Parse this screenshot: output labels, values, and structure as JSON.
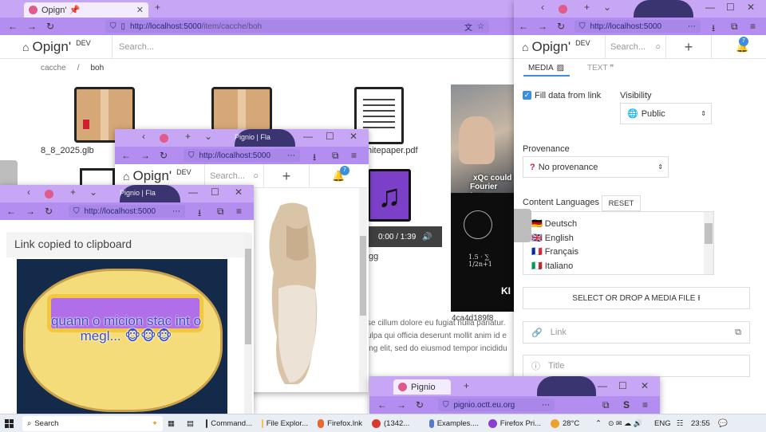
{
  "main": {
    "tab_title": "Opign' 📌",
    "url_prefix": "http://localhost:5000",
    "url_path": "/item/cacche/boh",
    "logo": "Opign'",
    "dev": "DEV",
    "search_placeholder": "Search...",
    "breadcrumb": [
      "cacche",
      "/",
      "boh"
    ],
    "files": [
      "8_8_2025.glb",
      "hitepaper.pdf",
      "gg"
    ],
    "audio_time": "0:00 / 1:39",
    "lorem": [
      "se cillum dolore eu fugiat nulla pariatur.",
      "ulpa qui officia deserunt mollit anim id e",
      "ing elit, sed do eiusmod tempor incididu"
    ],
    "video_caption": [
      "xQc could",
      "Fourier tran"
    ],
    "video_brand": "KI",
    "file_prefix": "4ca4d189f8"
  },
  "right": {
    "url": "http://localhost:5000",
    "logo": "Opign'",
    "dev": "DEV",
    "search_placeholder": "Search...",
    "badge": "7",
    "tab_media": "MEDIA",
    "tab_text": "TEXT ❞",
    "fill_label": "Fill data from link",
    "visibility_label": "Visibility",
    "visibility_value": "Public",
    "provenance_label": "Provenance",
    "provenance_value": "No provenance",
    "languages_label": "Content Languages",
    "reset": "RESET",
    "languages": [
      {
        "flag": "🇩🇪",
        "name": "Deutsch"
      },
      {
        "flag": "🇬🇧",
        "name": "English"
      },
      {
        "flag": "🇫🇷",
        "name": "Français"
      },
      {
        "flag": "🇮🇹",
        "name": "Italiano"
      }
    ],
    "drop_label": "SELECT OR DROP A MEDIA FILE ⭱",
    "link_placeholder": "Link",
    "title_placeholder": "Title"
  },
  "mid": {
    "tab_title": "Pignio | Fla",
    "url": "http://localhost:5000",
    "logo": "Opign'",
    "dev": "DEV",
    "search_placeholder": "Search...",
    "badge": "7"
  },
  "left": {
    "tab_title": "Pignio | Fla",
    "url": "http://localhost:5000",
    "toast": "Link copied to clipboard",
    "meme_text": "quann o micion stac int o megl... 🐵🐵🐵"
  },
  "bottom": {
    "tab_title": "Pignio",
    "url": "pignio.octt.eu.org"
  },
  "taskbar": {
    "search": "Search",
    "items": [
      "Command...",
      "File Explor...",
      "Firefox.lnk",
      "(1342...",
      "Examples....",
      "Firefox Pri..."
    ],
    "weather": "28°C",
    "lang": "ENG",
    "time": "23:55"
  },
  "colors": {
    "accent": "#3c8fdc",
    "frame": "#c7a6f5",
    "urlbar": "#a987e8",
    "taskbar": "#e9eef5"
  }
}
